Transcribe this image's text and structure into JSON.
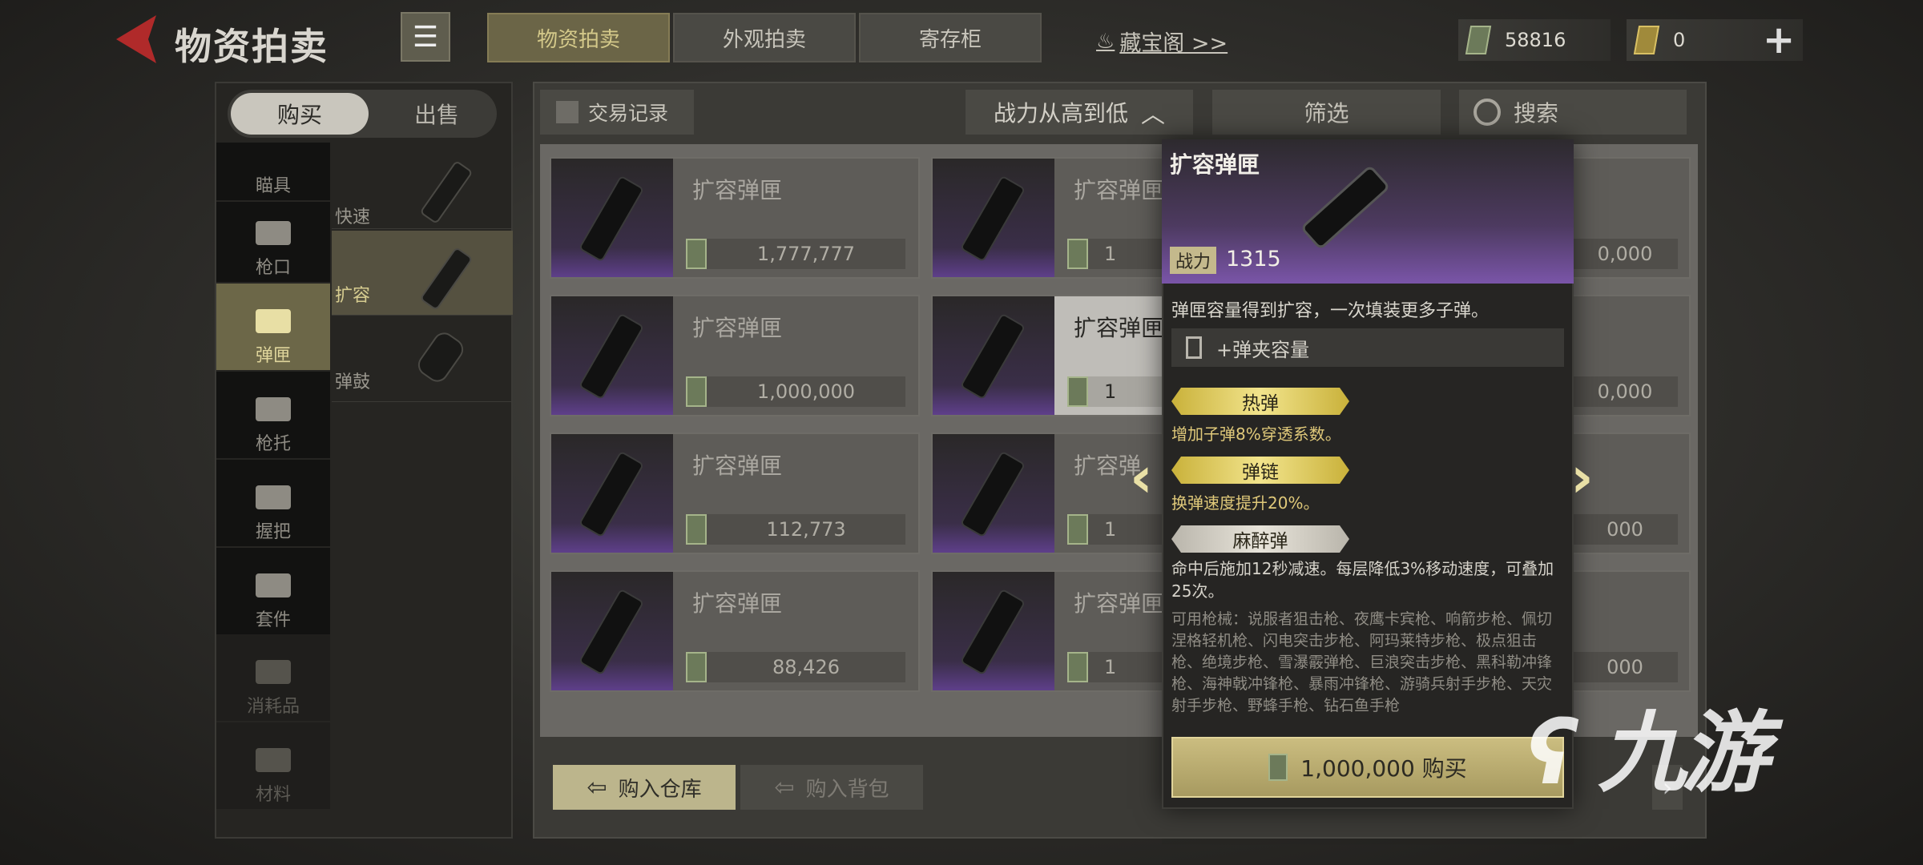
{
  "header": {
    "title": "物资拍卖",
    "tabs": [
      "物资拍卖",
      "外观拍卖",
      "寄存柜"
    ],
    "treasure_link": "藏宝阁 >>",
    "currency_cash": "58816",
    "currency_gold": "0"
  },
  "left": {
    "buy": "购买",
    "sell": "出售",
    "categories": [
      "瞄具",
      "枪口",
      "弹匣",
      "枪托",
      "握把",
      "套件",
      "消耗品",
      "材料"
    ],
    "subcategories": [
      "快速",
      "扩容",
      "弹鼓"
    ]
  },
  "toolbar": {
    "trade_record": "交易记录",
    "sort": "战力从高到低",
    "filter": "筛选",
    "search": "搜索"
  },
  "grid": {
    "col1": [
      {
        "name": "扩容弹匣",
        "price": "1,777,777"
      },
      {
        "name": "扩容弹匣",
        "price": "1,000,000"
      },
      {
        "name": "扩容弹匣",
        "price": "112,773"
      },
      {
        "name": "扩容弹匣",
        "price": "88,426"
      }
    ],
    "col2": [
      {
        "name": "扩容弹匣",
        "price": "1"
      },
      {
        "name": "扩容弹匣",
        "price": "1"
      },
      {
        "name": "扩容弹",
        "price": "1"
      },
      {
        "name": "扩容弹匣",
        "price": "1"
      }
    ],
    "col3": [
      {
        "price": "0,000"
      },
      {
        "price": "0,000"
      },
      {
        "price": "000"
      },
      {
        "price": "000"
      }
    ]
  },
  "bottom": {
    "buy_warehouse": "购入仓库",
    "buy_bag": "购入背包",
    "next": "›"
  },
  "popup": {
    "name": "扩容弹匣",
    "power_label": "战力",
    "power": "1315",
    "desc": "弹匣容量得到扩容，一次填装更多子弹。",
    "capacity": "+弹夹容量",
    "badge1": "热弹",
    "badge1_desc": "增加子弹8%穿透系数。",
    "badge2": "弹链",
    "badge2_desc": "换弹速度提升20%。",
    "badge3": "麻醉弹",
    "badge3_desc": "命中后施加12秒减速。每层降低3%移动速度，可叠加25次。",
    "weapons": "可用枪械：说服者狙击枪、夜鹰卡宾枪、响箭步枪、佩切涅格轻机枪、闪电突击步枪、阿玛莱特步枪、极点狙击枪、绝境步枪、雪瀑霰弹枪、巨浪突击步枪、黑科勒冲锋枪、海神戟冲锋枪、暴雨冲锋枪、游骑兵射手步枪、天灾射手步枪、野蜂手枪、钻石鱼手枪",
    "buy_price": "1,000,000 购买"
  },
  "watermark": "九游"
}
